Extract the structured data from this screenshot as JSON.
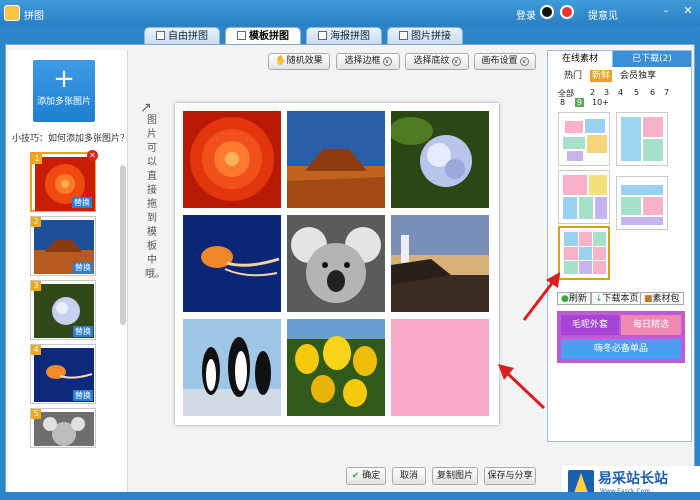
{
  "window": {
    "title": "拼图",
    "login": "登录",
    "feedback": "提意见"
  },
  "tabs": [
    {
      "label": "自由拼图",
      "active": false
    },
    {
      "label": "模板拼图",
      "active": true
    },
    {
      "label": "海报拼图",
      "active": false
    },
    {
      "label": "图片拼接",
      "active": false
    }
  ],
  "left_panel": {
    "add_label": "添加多张图片",
    "tip": "小技巧：如何添加多张图片？",
    "thumbs": [
      {
        "num": "1",
        "swap": "替换",
        "selected": true
      },
      {
        "num": "2",
        "swap": "替换",
        "selected": false
      },
      {
        "num": "3",
        "swap": "替换",
        "selected": false
      },
      {
        "num": "4",
        "swap": "替换",
        "selected": false
      },
      {
        "num": "5",
        "swap": "替换",
        "selected": false
      }
    ]
  },
  "toolbar": {
    "random": "随机效果",
    "border": "选择边框",
    "background": "选择底纹",
    "canvas": "画布设置"
  },
  "canvas_hint": "图片可以直接拖到模板中哦。",
  "bottom": {
    "ok": "确定",
    "cancel": "取消",
    "copy": "复制图片",
    "save": "保存与分享"
  },
  "right_panel": {
    "tab_online": "在线素材",
    "tab_downloaded": "已下载(2)",
    "filters": [
      "热门",
      "新鲜",
      "会员独享"
    ],
    "filter_selected": "新鲜",
    "count_label": "全部",
    "counts": [
      "2",
      "3",
      "4",
      "5",
      "6",
      "7",
      "8",
      "9",
      "10+"
    ],
    "count_selected": "9",
    "refresh": "刷新",
    "download_page": "下载本页",
    "pack": "素材包",
    "promo": [
      "毛呢外套",
      "每日精选",
      "嗨冬必备单品"
    ]
  },
  "watermark": {
    "title": "易采站长站",
    "sub": "Www.Easck.Com"
  },
  "colors": {
    "accent": "#2a86c8",
    "selected": "#f0a020",
    "pink_cell": "#f7a9c7"
  }
}
